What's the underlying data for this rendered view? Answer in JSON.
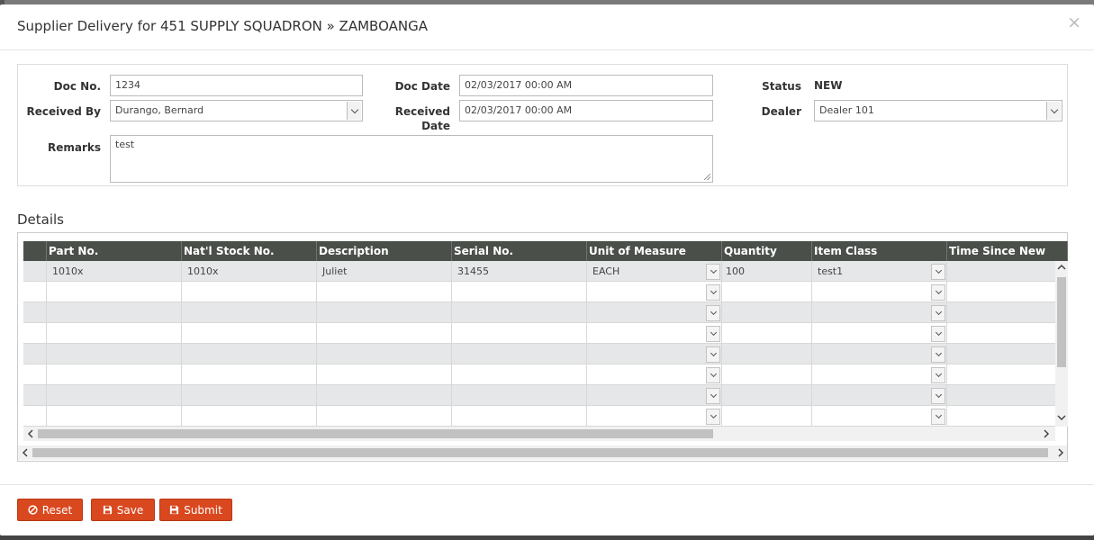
{
  "modal": {
    "title": "Supplier Delivery for 451 SUPPLY SQUADRON » ZAMBOANGA",
    "close_glyph": "×"
  },
  "form": {
    "doc_no_label": "Doc No.",
    "doc_no_value": "1234",
    "doc_date_label": "Doc Date",
    "doc_date_value": "02/03/2017 00:00 AM",
    "status_label": "Status",
    "status_value": "NEW",
    "received_by_label": "Received By",
    "received_by_value": "Durango, Bernard",
    "received_date_label_1": "Received",
    "received_date_label_2": "Date",
    "received_date_value": "02/03/2017 00:00 AM",
    "dealer_label": "Dealer",
    "dealer_value": "Dealer 101",
    "remarks_label": "Remarks",
    "remarks_value": "test"
  },
  "details": {
    "title": "Details",
    "columns": [
      "Part No.",
      "Nat'l Stock No.",
      "Description",
      "Serial No.",
      "Unit of Measure",
      "Quantity",
      "Item Class",
      "Time Since New"
    ],
    "rows": [
      [
        "1010x",
        "1010x",
        "Juliet",
        "31455",
        "EACH",
        "100",
        "test1",
        ""
      ],
      [
        "",
        "",
        "",
        "",
        "",
        "",
        "",
        ""
      ],
      [
        "",
        "",
        "",
        "",
        "",
        "",
        "",
        ""
      ],
      [
        "",
        "",
        "",
        "",
        "",
        "",
        "",
        ""
      ],
      [
        "",
        "",
        "",
        "",
        "",
        "",
        "",
        ""
      ],
      [
        "",
        "",
        "",
        "",
        "",
        "",
        "",
        ""
      ],
      [
        "",
        "",
        "",
        "",
        "",
        "",
        "",
        ""
      ],
      [
        "",
        "",
        "",
        "",
        "",
        "",
        "",
        ""
      ]
    ]
  },
  "buttons": {
    "reset": "Reset",
    "save": "Save",
    "submit": "Submit"
  },
  "colors": {
    "accent": "#d9481f",
    "grid_header": "#4a4f4a"
  }
}
